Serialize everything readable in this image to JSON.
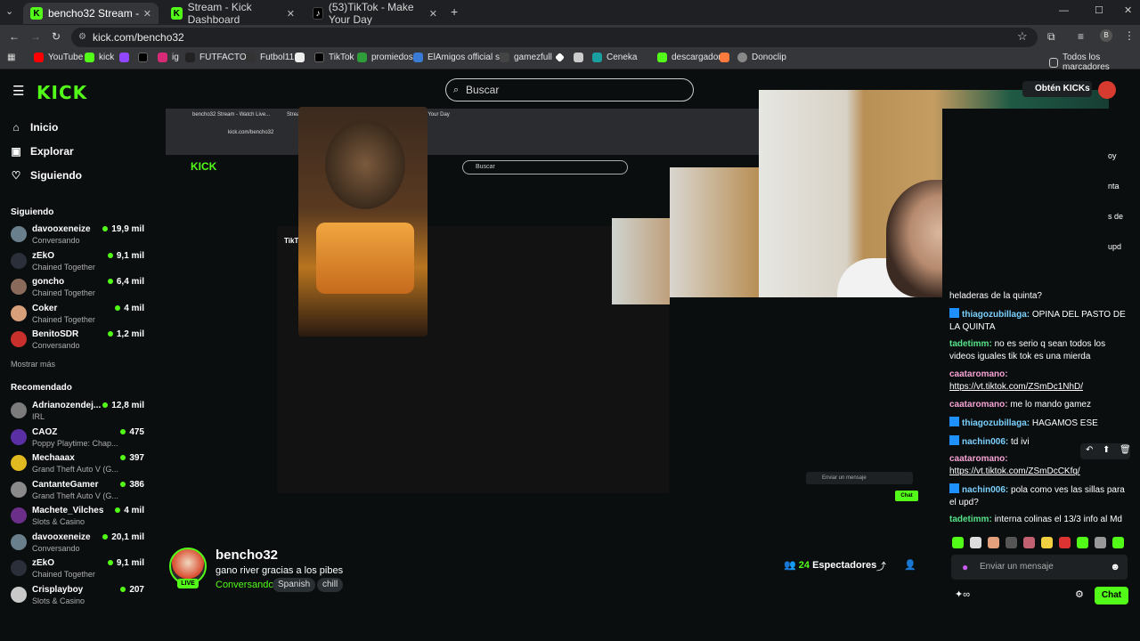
{
  "tabs": [
    {
      "label": "bencho32 Stream - Watch Live..."
    },
    {
      "label": "Stream - Kick Dashboard"
    },
    {
      "label": "(53)TikTok - Make Your Day"
    }
  ],
  "address": {
    "url": "kick.com/bencho32"
  },
  "bookmarks": [
    "YouTube",
    "kick",
    "ig",
    "FUTFACTOS",
    "Futbol11",
    "TikTok",
    "promiedos",
    "ElAmigos official site",
    "gamezfull",
    "Ceneka",
    "descargador",
    "Donoclip"
  ],
  "bookmarks_all": "Todos los marcadores",
  "header": {
    "logo": "KICK",
    "search_placeholder": "Buscar",
    "get_kicks": "Obtén KICKs"
  },
  "sidebar": {
    "nav": [
      {
        "label": "Inicio",
        "icon": "home-icon"
      },
      {
        "label": "Explorar",
        "icon": "compass-icon"
      },
      {
        "label": "Siguiendo",
        "icon": "heart-icon"
      }
    ],
    "following_title": "Siguiendo",
    "following": [
      {
        "name": "davooxeneize",
        "category": "Conversando",
        "viewers": "19,9 mil",
        "color": "#6a7f8c"
      },
      {
        "name": "zEkO",
        "category": "Chained Together",
        "viewers": "9,1 mil",
        "color": "#2a2f3a"
      },
      {
        "name": "goncho",
        "category": "Chained Together",
        "viewers": "6,4 mil",
        "color": "#8a6a5a"
      },
      {
        "name": "Coker",
        "category": "Chained Together",
        "viewers": "4 mil",
        "color": "#d7a07a"
      },
      {
        "name": "BenitoSDR",
        "category": "Conversando",
        "viewers": "1,2 mil",
        "color": "#c8312b"
      }
    ],
    "show_more": "Mostrar más",
    "recommended_title": "Recomendado",
    "recommended": [
      {
        "name": "Adrianozendej...",
        "category": "IRL",
        "viewers": "12,8 mil",
        "color": "#7b7b7b"
      },
      {
        "name": "CAOZ",
        "category": "Poppy Playtime: Chap...",
        "viewers": "475",
        "color": "#5a2fa3"
      },
      {
        "name": "Mechaaax",
        "category": "Grand Theft Auto V (G...",
        "viewers": "397",
        "color": "#e0b81f"
      },
      {
        "name": "CantanteGamer",
        "category": "Grand Theft Auto V (G...",
        "viewers": "386",
        "color": "#8a8a8a"
      },
      {
        "name": "Machete_Vilches",
        "category": "Slots & Casino",
        "viewers": "4 mil",
        "color": "#6b2f8a"
      },
      {
        "name": "davooxeneize",
        "category": "Conversando",
        "viewers": "20,1 mil",
        "color": "#6a7f8c"
      },
      {
        "name": "zEkO",
        "category": "Chained Together",
        "viewers": "9,1 mil",
        "color": "#2a2f3a"
      },
      {
        "name": "Crisplayboy",
        "category": "Slots & Casino",
        "viewers": "207",
        "color": "#c9c9c9"
      }
    ]
  },
  "stream": {
    "streamer": "bencho32",
    "title": "gano river gracias a los pibes",
    "category": "Conversando",
    "tags": [
      "Spanish",
      "chill"
    ],
    "viewers_count": "24",
    "viewers_label": "Espectadores",
    "live": "LIVE"
  },
  "inner_capture": {
    "url": "kick.com/bencho32",
    "search": "Buscar",
    "tiktok_logo": "TikTok",
    "chat_input": "Enviar un mensaje",
    "chat_btn": "Chat"
  },
  "chat": {
    "partial_lines": [
      "oy",
      "nta",
      "s de",
      "upd"
    ],
    "messages": [
      {
        "user": "",
        "text": "heladeras de la quinta?",
        "color": "blue",
        "badge": false
      },
      {
        "user": "thiagozubillaga:",
        "text": " OPINA DEL PASTO DE LA QUINTA",
        "color": "blue",
        "badge": true
      },
      {
        "user": "tadetimm:",
        "text": " no es serio q sean todos los videos iguales tik tok es una mierda",
        "color": "green",
        "badge": false
      },
      {
        "user": "caataromano:",
        "text": "",
        "link": "https://vt.tiktok.com/ZSmDc1NhD/",
        "color": "pink",
        "badge": false
      },
      {
        "user": "caataromano:",
        "text": " me lo mando gamez",
        "color": "pink",
        "badge": false
      },
      {
        "user": "thiagozubillaga:",
        "text": " HAGAMOS ESE",
        "color": "blue",
        "badge": true
      },
      {
        "user": "nachin006:",
        "text": " td ivi",
        "color": "blue",
        "badge": true
      },
      {
        "user": "caataromano:",
        "text": "",
        "link": "https://vt.tiktok.com/ZSmDcCKfq/",
        "color": "pink",
        "badge": false
      },
      {
        "user": "nachin006:",
        "text": " pola como ves las sillas para el upd?",
        "color": "blue",
        "badge": true
      },
      {
        "user": "tadetimm:",
        "text": " interna colinas el 13/3 info al Md",
        "color": "green",
        "badge": false
      }
    ],
    "input_placeholder": "Enviar un mensaje",
    "send_label": "Chat"
  },
  "colors": {
    "brand": "#53fc18",
    "bg": "#0b0e0f"
  }
}
